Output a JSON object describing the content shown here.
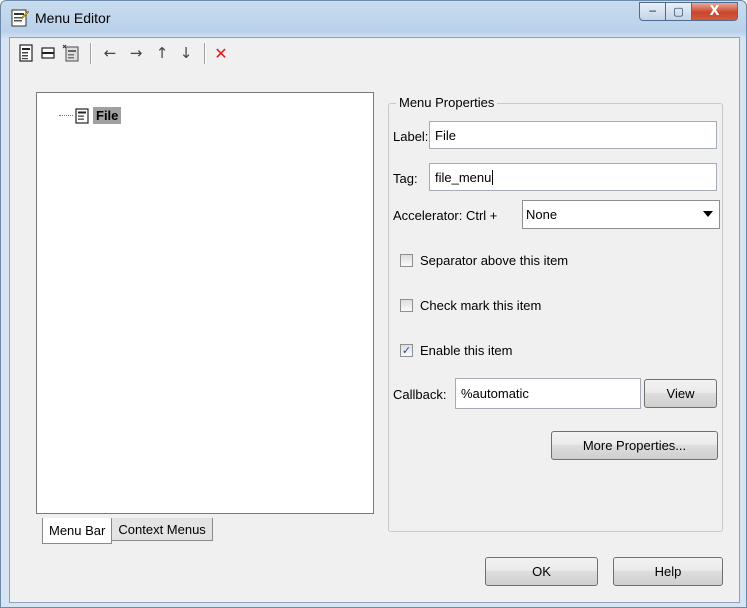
{
  "window": {
    "title": "Menu Editor"
  },
  "toolbar": {
    "icons": [
      "new-menu-icon",
      "new-separator-icon",
      "new-menu-item-icon",
      "move-left-icon",
      "move-right-icon",
      "move-up-icon",
      "move-down-icon",
      "delete-icon"
    ],
    "arrow_left": "←",
    "arrow_right": "→",
    "arrow_up": "↑",
    "arrow_down": "↓",
    "delete": "✕"
  },
  "tree": {
    "items": [
      {
        "label": "File",
        "selected": true
      }
    ]
  },
  "tabs": [
    {
      "label": "Menu Bar",
      "active": true
    },
    {
      "label": "Context Menus",
      "active": false
    }
  ],
  "properties": {
    "group_title": "Menu Properties",
    "label_caption": "Label:",
    "label_value": "File",
    "tag_caption": "Tag:",
    "tag_value": "file_menu",
    "accelerator_caption": "Accelerator: Ctrl +",
    "accelerator_value": "None",
    "separator_label": "Separator above this item",
    "separator_checked": false,
    "checkmark_label": "Check mark this item",
    "checkmark_checked": false,
    "enable_label": "Enable this item",
    "enable_checked": true,
    "check_glyph": "✓",
    "callback_caption": "Callback:",
    "callback_value": "%automatic",
    "view_button": "View",
    "more_properties_button": "More Properties..."
  },
  "footer": {
    "ok_button": "OK",
    "help_button": "Help"
  },
  "caption_buttons": {
    "minimize": "─",
    "maximize": "▢",
    "close": "X"
  },
  "colors": {
    "title_bar": "#b9d1ea",
    "client": "#f0f0f0",
    "close_button": "#c9452c",
    "delete_icon": "#e0191b",
    "selection": "#a0a0a0"
  }
}
